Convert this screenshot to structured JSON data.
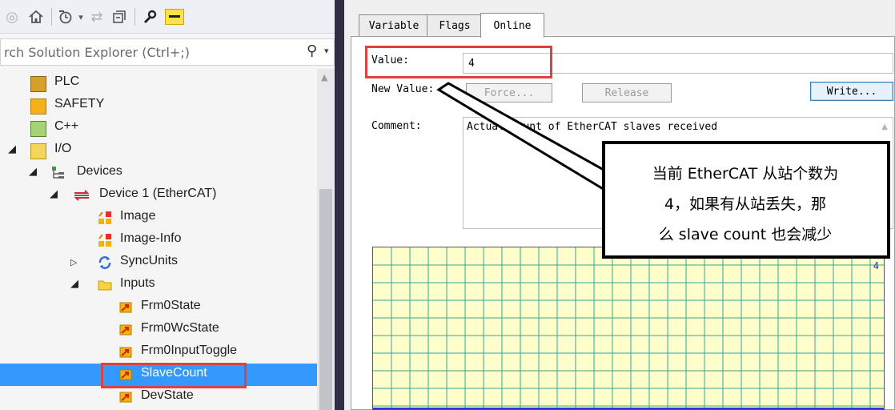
{
  "toolbar": {
    "icons": [
      "back-icon",
      "home-icon",
      "history-icon",
      "forward-icon",
      "collapse-icon",
      "wrench-icon",
      "pin-icon"
    ]
  },
  "search": {
    "placeholder": "rch Solution Explorer (Ctrl+;)"
  },
  "tree": {
    "items": [
      {
        "label": "PLC",
        "icon": "plc-icon"
      },
      {
        "label": "SAFETY",
        "icon": "safety-icon"
      },
      {
        "label": "C++",
        "icon": "cpp-icon"
      },
      {
        "label": "I/O",
        "icon": "io-icon"
      },
      {
        "label": "Devices",
        "icon": "devices-icon"
      },
      {
        "label": "Device 1 (EtherCAT)",
        "icon": "ethercat-device-icon"
      },
      {
        "label": "Image",
        "icon": "image-icon"
      },
      {
        "label": "Image-Info",
        "icon": "image-info-icon"
      },
      {
        "label": "SyncUnits",
        "icon": "sync-icon"
      },
      {
        "label": "Inputs",
        "icon": "folder-icon"
      },
      {
        "label": "Frm0State",
        "icon": "input-var-icon"
      },
      {
        "label": "Frm0WcState",
        "icon": "input-var-icon"
      },
      {
        "label": "Frm0InputToggle",
        "icon": "input-var-icon"
      },
      {
        "label": "SlaveCount",
        "icon": "input-var-icon",
        "selected": true
      },
      {
        "label": "DevState",
        "icon": "input-var-icon"
      }
    ]
  },
  "tabs": [
    {
      "label": "Variable"
    },
    {
      "label": "Flags"
    },
    {
      "label": "Online",
      "active": true
    }
  ],
  "online": {
    "value_label": "Value:",
    "value": "4",
    "new_value_label": "New Value:",
    "force_button": "Force...",
    "release_button": "Release",
    "write_button": "Write...",
    "comment_label": "Comment:",
    "comment": "Actual count of EtherCAT slaves received",
    "chart_value": "4"
  },
  "annotation": {
    "text_line1": "当前 EtherCAT 从站个数为",
    "text_line2": "4，如果有从站丢失，那",
    "text_line3": "么 slave count 也会减少"
  },
  "colors": {
    "selection": "#3399ff",
    "highlight_box": "#e04040",
    "chart_bg": "#ffffcc",
    "chart_grid": "#33aa99"
  }
}
